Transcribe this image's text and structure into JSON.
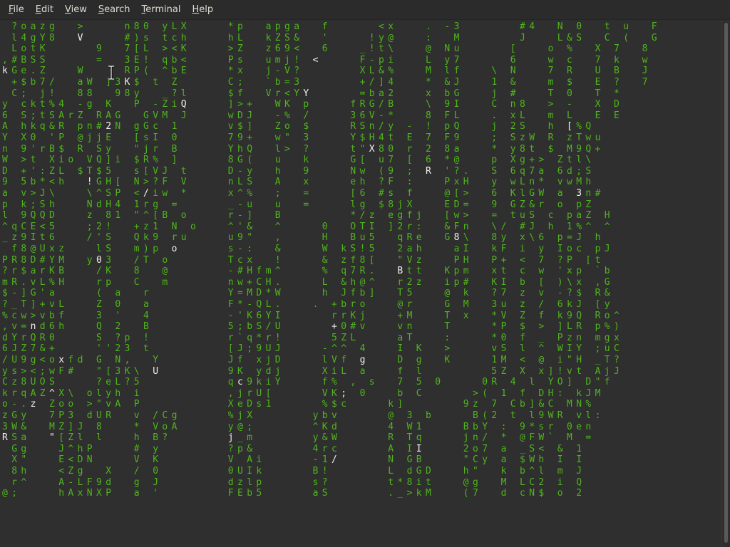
{
  "menubar": {
    "items": [
      {
        "label": "File",
        "mnemonic": "F"
      },
      {
        "label": "Edit",
        "mnemonic": "E"
      },
      {
        "label": "View",
        "mnemonic": "V"
      },
      {
        "label": "Search",
        "mnemonic": "S"
      },
      {
        "label": "Terminal",
        "mnemonic": "T"
      },
      {
        "label": "Help",
        "mnemonic": "H"
      }
    ]
  },
  "terminal": {
    "rows": [
      "  ? o a z g     >         n 8 0   y L X         * p     a p g a     f           < x       .   - 3             # 4     N   0     t   u     F",
      "  l 4 g Y 8     V         # ) s   t c h         h L     k Z S &     '         ! y @       :     M             J       L & S     C   (     G",
      "  L o t K           9     7 [ L   > < K         > Z     z 6 9 <     6       _ ! t \\       @   N u           [       o   %     X   7     8",
      ", # B S S           =     3 E !   q b <         P s     u m j !   <         F - p i       L   y 7           6       w   c     7   k     w",
      "k G e . Z       W         R P (   ^ b E         * x     j - V ?             X L & %       M   l f       \\   N       7   R     U   B     J",
      "  + $ b 7 /     a W   ] 3 K $   t   Z           C ;     ` b = 3             + / ] 4       *   & J       1   &       m   $     E   ?     7",
      "  C ;   j !     8 8     9 8 y     _ ? l         $ f     V r < Y Y           = b a 2       x   b G       j   #       T   0     T   *",
      "y   c k t % 4   - g   K     P   - Z i Q         ] > +     W K   p         f R G / B       \\   9 I       C   n 8     >   -     X   D",
      "6   S ; t S A r Z   R A G     G V M   J         w D J     - %   /         3 6 V - *       8   F L       .   x L     m   L     E   E",
      "A   h k q & R   p n # 2 N   g G c   1           v $ ]     Z o   $         R S n / y   -   !   p Q       j   2 S     h   [ % Q",
      "Y   X 0   ' P   @ j j E     [ s I   0           7 9 +     w \"   3         Y $ H 4 t   E   7   F 9       ;   S z W   R   z T w u",
      "n   9 ' r B $   R   S y     \" j r   B           Y h Q     l >   ?         t \" X 8 0   r   2   8 a       *   y 8 t   $   M 9 Q +",
      "W   > t   X i o   V Q ] i   $ R %   ]           8 G (     u     k         G [   u 7   [   6   * @       p   X g + >   Z t l \\",
      "D   + ' : Z L   $ T $ 5     s [ V J   t         D - y     h     9         N w   ( 9   ;   R   ' ? .     S   6 q 7 a   6 d ; S",
      "9   5 b * < h     ! G H [   N > ? F   V         n L S     A     x         e h   ? F   :       P x H     y   w L n *   v w M h",
      "a   v > J \\       \\ ^ S P   < / i w   *         x ^ %     ;     =         [ 6   # s   f       @ [ >     6   K l G W   a   3 n #",
      "p   k ; S h       N d H 4   1 r g   =           _ - u     u     =         l g   $ 8 j X       E D =     9   G Z & r   o   p Z",
      "l   9 Q Q D       z   8 1   \" ^ [ B   o         r - ]     B               * / z   e g f j     [ w >     =   t u S   c   p a Z   H",
      "^ q C E < 5       ; 2 !     + z 1   N   o       ^ ' &     ^         0     O T I   ] 2 r :     & F n     \\ /   # J   h   1 % ^   ^",
      "_ z 9 I t 6       / ' S     Q k 9   r u         u 9 \"     ,         H     B u 5     q R e     G 8 \\     8 y   x \\ 6   p = J   h",
      "  f 8 @ U x z       l S     m ) p   o           s - :     &         W   k S ! 5     2 a h       a I     k F   i   y   I o c   p J",
      "P R 8 D # Y M     y 0 3     / T   o             T c x     !         &   z f 8 [     \" V z       P H     P +   <   7   ? P   [ t",
      "? r $ a r K B       / K     8     @             - # H f m ^         %   q 7 R .     B t t     K p m     x t   c   w   ' x p   ` b",
      "m R . v L % H       r p     C     m             n w + C H .         L   & h @ ^     r 2 z     i p #     K I   b   [   ) \\ x   , G",
      "$ - ] G ' a         (   a     r                 Y = M D * W         h   J f b ]     T 5       @   k     ? 7   z   v   - ? $   R &",
      "? _ T ] + v L       Z   0     a                 F * - Q L .       .   + b r o       @ r       G   M     3 u   z   /   6 k J   [ y",
      "% c w > v b f       3   '     4                 - ' K 6 Y I           r r K j       + M       T   x     * V   Z   f   k 9 Q   R o ^",
      ", v = n d 6 h       Q   2     B                 5 ; b S / U           + 0 # v       v n       T         * P   $   >   ] L R   p % )",
      "d Y r Q R 0         S   ? p   !                 r ` q * r !           5 Z L         a T       :         * 0   f   _   P z n   m g x",
      "6 J Z 7 & +         ' ' 2 3   t                 [ J ; 9 U J         - ^ ^   4       I   K     >         v S   l   ^   W I Y   ; u C",
      "/ U 9 g < o x f d   G   N ,     Y               J f   x j D         l V f   g       D   g     K         1 M   <   @   i \" H   _ T ?",
      "y s > < ; w F #     \" [ 3 K \\   U               9 K   y d j         X i L   a       f   l               5 Z   X   x ] ! v t   A j J",
      "C z 8 U O S         ? e L ? 5                   q c 9 k i Y         f %   ,   s     7   5   0         0 R   4   l   Y O ]   D \" f",
      "k r q A Z ^ X \\   o l y h   i                   , j r U [           V K ;   0       b   C           > (   1   f   D H :   k J M",
      "o - . z   Z o o   > \" v A   P                   X e D s 1           % $ c         k ]             9 z   7   C b ] & C   M N %",
      "z G y     7 P 3   d U R     v   / C g           % j X             y b v           @   3   b         B ( 2   t   l 9 W R   v l :",
      "3 W &     M Z ] J   8       *   V o A           y @ ;             ^ K d           4   W 1         B b Y   :   9 * s r   0 e n",
      "R S a     \" [ Z l   l       h   B ?             j _ m             y & W           R   T q         j n /   *   @ F W `   M   =",
      "  G g       J ^ h P         #   y               ? p &             4 r c           A   I I         2 o 7   a   _ S <   &   1",
      "  X \"       E < D N         V   K               V   A i           - 1 /           N   G B         \" C y   a   $ W h   I   I",
      "  8 h       < Z g     X     /   0               0 U I k           B !             L   d G D       h \"     k   b ^ l   m   J",
      "  r ^       A - L F 9 d     g   J               d z l p           s ?             t * 8 i t       @ g     M   L C 2   i   Q",
      "@ ;         h A x N X P     a   '               F E b 5           a S             . _ > k M       ( 7     d   c N $   o   2"
    ],
    "highlighted": [
      {
        "row": 0,
        "col": 120,
        "ch": "4"
      },
      {
        "row": 1,
        "col": 16,
        "ch": "V"
      },
      {
        "row": 1,
        "col": 136,
        "ch": "&"
      },
      {
        "row": 3,
        "col": 66,
        "ch": "<"
      },
      {
        "row": 4,
        "col": 0,
        "ch": "k"
      },
      {
        "row": 4,
        "col": 40,
        "ch": "b"
      },
      {
        "row": 5,
        "col": 26,
        "ch": "K"
      },
      {
        "row": 5,
        "col": 132,
        "ch": "$"
      },
      {
        "row": 5,
        "col": 148,
        "ch": "7"
      },
      {
        "row": 6,
        "col": 64,
        "ch": "Y"
      },
      {
        "row": 7,
        "col": 38,
        "ch": "i"
      },
      {
        "row": 9,
        "col": 14,
        "ch": "q"
      },
      {
        "row": 9,
        "col": 22,
        "ch": "p"
      },
      {
        "row": 9,
        "col": 120,
        "ch": "2"
      },
      {
        "row": 11,
        "col": 78,
        "ch": "X"
      },
      {
        "row": 11,
        "col": 56,
        "ch": ">"
      },
      {
        "row": 13,
        "col": 90,
        "ch": "R"
      },
      {
        "row": 14,
        "col": 18,
        "ch": "h"
      },
      {
        "row": 14,
        "col": 140,
        "ch": "h"
      },
      {
        "row": 15,
        "col": 30,
        "ch": "<"
      },
      {
        "row": 15,
        "col": 122,
        "ch": "G"
      },
      {
        "row": 16,
        "col": 26,
        "ch": "H"
      },
      {
        "row": 16,
        "col": 60,
        "ch": "="
      },
      {
        "row": 18,
        "col": 80,
        "ch": "]"
      },
      {
        "row": 19,
        "col": 96,
        "ch": "G"
      },
      {
        "row": 20,
        "col": 36,
        "ch": ")"
      },
      {
        "row": 21,
        "col": 20,
        "ch": "y"
      },
      {
        "row": 21,
        "col": 40,
        "ch": "T"
      },
      {
        "row": 22,
        "col": 84,
        "ch": "z"
      },
      {
        "row": 23,
        "col": 42,
        "ch": "m"
      },
      {
        "row": 23,
        "col": 100,
        "ch": "p"
      },
      {
        "row": 25,
        "col": 62,
        "ch": "."
      },
      {
        "row": 26,
        "col": 108,
        "ch": "x"
      },
      {
        "row": 27,
        "col": 6,
        "ch": "n"
      },
      {
        "row": 27,
        "col": 70,
        "ch": "#"
      },
      {
        "row": 27,
        "col": 80,
        "ch": "v"
      },
      {
        "row": 30,
        "col": 12,
        "ch": "o"
      },
      {
        "row": 30,
        "col": 76,
        "ch": "g"
      },
      {
        "row": 31,
        "col": 30,
        "ch": "3"
      },
      {
        "row": 31,
        "col": 32,
        "ch": "K"
      },
      {
        "row": 32,
        "col": 50,
        "ch": "9"
      },
      {
        "row": 33,
        "col": 10,
        "ch": "Z"
      },
      {
        "row": 33,
        "col": 72,
        "ch": "0"
      },
      {
        "row": 34,
        "col": 6,
        "ch": "z"
      },
      {
        "row": 34,
        "col": 30,
        "ch": "\""
      },
      {
        "row": 34,
        "col": 34,
        "ch": "A"
      },
      {
        "row": 34,
        "col": 134,
        "ch": "C"
      },
      {
        "row": 35,
        "col": 26,
        "ch": "U"
      },
      {
        "row": 36,
        "col": 46,
        "ch": "A"
      },
      {
        "row": 36,
        "col": 138,
        "ch": "e"
      },
      {
        "row": 37,
        "col": 0,
        "ch": "R"
      },
      {
        "row": 37,
        "col": 10,
        "ch": "\""
      },
      {
        "row": 37,
        "col": 48,
        "ch": "?"
      },
      {
        "row": 37,
        "col": 36,
        "ch": "l"
      },
      {
        "row": 38,
        "col": 88,
        "ch": "_"
      },
      {
        "row": 39,
        "col": 70,
        "ch": "/"
      },
      {
        "row": 39,
        "col": 104,
        "ch": "y"
      }
    ]
  },
  "icons": {
    "cursor": "ibeam-cursor-icon"
  },
  "colors": {
    "menubar_bg": "#2b2b2b",
    "terminal_bg": "#2f2f2f",
    "rain_green": "#4fb51c",
    "rain_white": "#f0f0f0",
    "menu_text": "#dfdbd2"
  }
}
